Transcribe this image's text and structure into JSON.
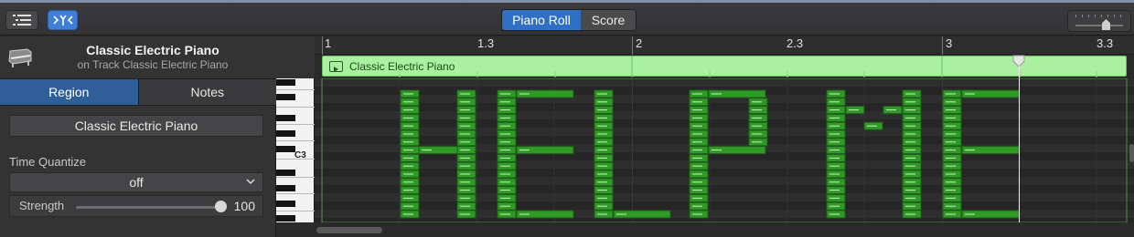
{
  "toolbar": {
    "list_icon": "list-icon",
    "filter_icon": "catch-icon",
    "tabs": [
      {
        "label": "Piano Roll",
        "active": true
      },
      {
        "label": "Score",
        "active": false
      }
    ],
    "zoom_icon": "zoom-slider"
  },
  "inspector": {
    "track_title": "Classic Electric Piano",
    "track_subtitle": "on Track Classic Electric Piano",
    "tabs": [
      {
        "label": "Region",
        "active": true
      },
      {
        "label": "Notes",
        "active": false
      }
    ],
    "region_name": "Classic Electric Piano",
    "time_quantize_label": "Time Quantize",
    "time_quantize_value": "off",
    "strength_label": "Strength",
    "strength_value": "100",
    "strength_level": 1.0
  },
  "keyboard": {
    "c3_label": "C3"
  },
  "ruler": {
    "markers": [
      "1",
      "1.3",
      "2",
      "2.3",
      "3",
      "3.3"
    ]
  },
  "region": {
    "label": "Classic Electric Piano",
    "color": "#a9f0a0"
  },
  "colors": {
    "accent": "#2f6fc4",
    "note_fill": "#2f9a26",
    "note_border": "#1d5e18"
  }
}
